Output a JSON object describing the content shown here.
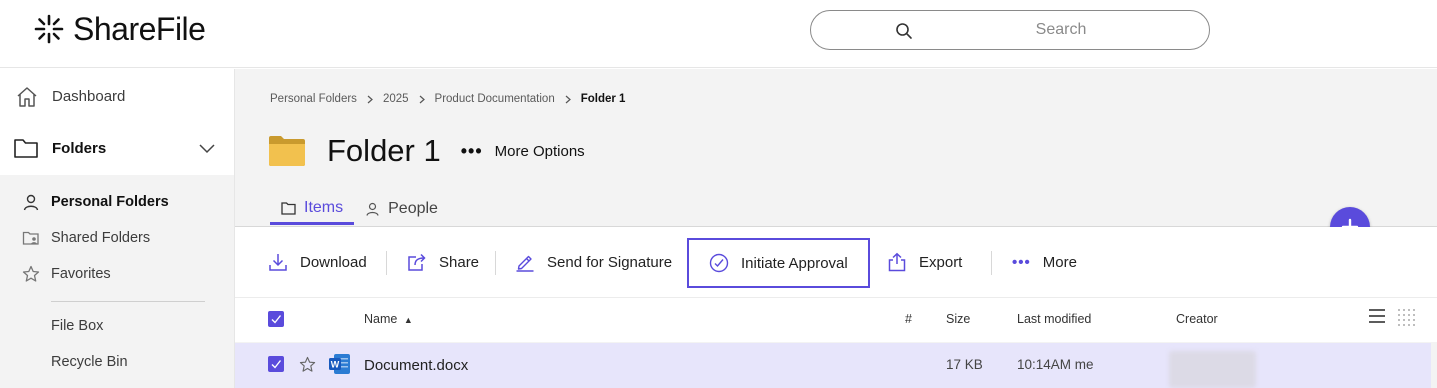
{
  "app": {
    "logo_text": "ShareFile"
  },
  "search": {
    "placeholder": "Search"
  },
  "sidebar": {
    "dashboard": "Dashboard",
    "folders": "Folders",
    "sub_items": [
      {
        "label": "Personal Folders",
        "icon": "person-icon",
        "active": true
      },
      {
        "label": "Shared Folders",
        "icon": "shared-folders-icon",
        "active": false
      },
      {
        "label": "Favorites",
        "icon": "star-icon",
        "active": false
      },
      {
        "label": "File Box",
        "icon": "",
        "active": false
      },
      {
        "label": "Recycle Bin",
        "icon": "",
        "active": false
      }
    ]
  },
  "breadcrumb": [
    "Personal Folders",
    "2025",
    "Product Documentation",
    "Folder 1"
  ],
  "folder": {
    "title": "Folder 1",
    "more_options": "More Options",
    "more_dots": "•••"
  },
  "tabs": [
    {
      "label": "Items",
      "active": true
    },
    {
      "label": "People",
      "active": false
    }
  ],
  "toolbar": {
    "download": "Download",
    "share": "Share",
    "send_for_signature": "Send for Signature",
    "initiate_approval": "Initiate Approval",
    "export": "Export",
    "more": "More",
    "more_dots": "•••"
  },
  "table": {
    "columns": {
      "name": "Name",
      "name_sort": "▲",
      "number": "#",
      "size": "Size",
      "last_modified": "Last modified",
      "creator": "Creator"
    },
    "rows": [
      {
        "name": "Document.docx",
        "size": "17 KB",
        "last_modified": "10:14AM me",
        "selected": true
      }
    ]
  },
  "colors": {
    "accent": "#5a4bdc",
    "selected_row": "#e7e5fb",
    "panel_bg": "#f3f3f3",
    "folder_yellow": "#f2c14e"
  }
}
